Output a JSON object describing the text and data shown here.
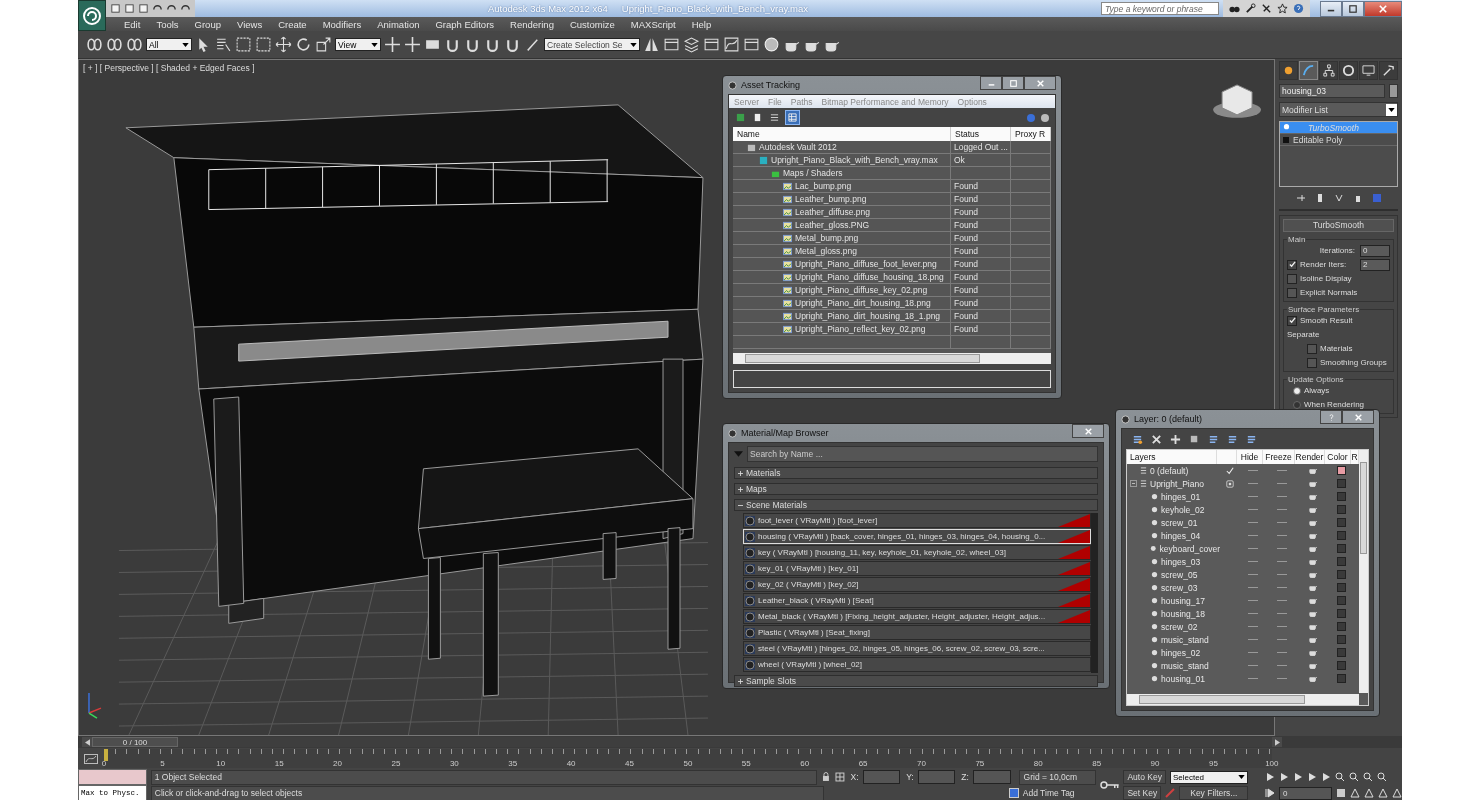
{
  "title_bar": {
    "app_title": "Autodesk 3ds Max  2012 x64",
    "file_name": "Upright_Piano_Black_with_Bench_vray.max",
    "search": {
      "placeholder": "Type a keyword or phrase"
    }
  },
  "menu": [
    "Edit",
    "Tools",
    "Group",
    "Views",
    "Create",
    "Modifiers",
    "Animation",
    "Graph Editors",
    "Rendering",
    "Customize",
    "MAXScript",
    "Help"
  ],
  "toolbar": {
    "selection_filter": "All",
    "reference_coord": "View",
    "selection_set": "Create Selection Se"
  },
  "viewport": {
    "label": "[ + ] [ Perspective ] [ Shaded + Edged Faces ]"
  },
  "asset_tracking": {
    "title": "Asset Tracking",
    "menu": [
      "Server",
      "File",
      "Paths",
      "Bitmap Performance and Memory",
      "Options"
    ],
    "tools": [
      {
        "kind": "refresh",
        "selected": false
      },
      {
        "kind": "page",
        "selected": false
      },
      {
        "kind": "list",
        "selected": false
      },
      {
        "kind": "table",
        "selected": true
      }
    ],
    "columns": [
      "Name",
      "Status",
      "Proxy R"
    ],
    "tree": [
      {
        "name": "Autodesk Vault 2012",
        "status": "Logged Out ...",
        "kind": "vault",
        "children": [
          {
            "name": "Upright_Piano_Black_with_Bench_vray.max",
            "status": "Ok",
            "kind": "scene",
            "children": [
              {
                "name": "Maps / Shaders",
                "kind": "folder",
                "children": [
                  {
                    "name": "Lac_bump.png",
                    "status": "Found",
                    "kind": "image"
                  },
                  {
                    "name": "Leather_bump.png",
                    "status": "Found",
                    "kind": "image"
                  },
                  {
                    "name": "Leather_diffuse.png",
                    "status": "Found",
                    "kind": "image"
                  },
                  {
                    "name": "Leather_gloss.PNG",
                    "status": "Found",
                    "kind": "image"
                  },
                  {
                    "name": "Metal_bump.png",
                    "status": "Found",
                    "kind": "image"
                  },
                  {
                    "name": "Metal_gloss.png",
                    "status": "Found",
                    "kind": "image"
                  },
                  {
                    "name": "Upright_Piano_diffuse_foot_lever.png",
                    "status": "Found",
                    "kind": "image"
                  },
                  {
                    "name": "Upright_Piano_diffuse_housing_18.png",
                    "status": "Found",
                    "kind": "image"
                  },
                  {
                    "name": "Upright_Piano_diffuse_key_02.png",
                    "status": "Found",
                    "kind": "image"
                  },
                  {
                    "name": "Upright_Piano_dirt_housing_18.png",
                    "status": "Found",
                    "kind": "image"
                  },
                  {
                    "name": "Upright_Piano_dirt_housing_18_1.png",
                    "status": "Found",
                    "kind": "image"
                  },
                  {
                    "name": "Upright_Piano_reflect_key_02.png",
                    "status": "Found",
                    "kind": "image"
                  }
                ]
              }
            ]
          }
        ]
      }
    ]
  },
  "material_browser": {
    "title": "Material/Map Browser",
    "search": {
      "placeholder": "Search by Name ..."
    },
    "groups": [
      {
        "label": "Materials",
        "expanded": false
      },
      {
        "label": "Maps",
        "expanded": false
      },
      {
        "label": "Scene Materials",
        "expanded": true,
        "items": [
          {
            "text": "foot_lever  ( VRayMtl ) [foot_lever]",
            "selected": false,
            "flagged": true
          },
          {
            "text": "housing  ( VRayMtl ) [back_cover, hinges_01, hinges_03, hinges_04, housing_0...",
            "selected": true,
            "flagged": true
          },
          {
            "text": "key  ( VRayMtl ) [housing_11, key, keyhole_01, keyhole_02, wheel_03]",
            "selected": false,
            "flagged": true
          },
          {
            "text": "key_01  ( VRayMtl ) [key_01]",
            "selected": false,
            "flagged": true
          },
          {
            "text": "key_02  ( VRayMtl ) [key_02]",
            "selected": false,
            "flagged": true
          },
          {
            "text": "Leather_black  ( VRayMtl ) [Seat]",
            "selected": false,
            "flagged": true
          },
          {
            "text": "Metal_black  ( VRayMtl ) [Fixing_height_adjuster, Height_adjuster, Height_adjus...",
            "selected": false,
            "flagged": true
          },
          {
            "text": "Plastic  ( VRayMtl ) [Seat_fixing]",
            "selected": false,
            "flagged": false
          },
          {
            "text": "steel  ( VRayMtl ) [hinges_02, hinges_05, hinges_06, screw_02, screw_03, scre...",
            "selected": false,
            "flagged": false
          },
          {
            "text": "wheel  ( VRayMtl ) [wheel_02]",
            "selected": false,
            "flagged": false
          }
        ]
      },
      {
        "label": "Sample Slots",
        "expanded": false
      }
    ]
  },
  "layer_manager": {
    "title": "Layer: 0 (default)",
    "columns": [
      "Layers",
      "Hide",
      "Freeze",
      "Render",
      "Color",
      "R"
    ],
    "layers": [
      {
        "name": "0 (default)",
        "current": true,
        "color": "#e89ca4"
      },
      {
        "name": "Upright_Piano",
        "current": false,
        "expanded": true,
        "color": "#3a3a3a",
        "children": [
          {
            "name": "hinges_01"
          },
          {
            "name": "keyhole_02"
          },
          {
            "name": "screw_01"
          },
          {
            "name": "hinges_04"
          },
          {
            "name": "keyboard_cover"
          },
          {
            "name": "hinges_03"
          },
          {
            "name": "screw_05"
          },
          {
            "name": "screw_03"
          },
          {
            "name": "housing_17"
          },
          {
            "name": "housing_18"
          },
          {
            "name": "screw_02"
          },
          {
            "name": "music_stand"
          },
          {
            "name": "hinges_02"
          },
          {
            "name": "music_stand"
          },
          {
            "name": "housing_01"
          }
        ]
      }
    ]
  },
  "command_panel": {
    "tabs": [
      {
        "kind": "create",
        "selected": false
      },
      {
        "kind": "modify",
        "selected": true
      },
      {
        "kind": "hierarchy",
        "selected": false
      },
      {
        "kind": "motion",
        "selected": false
      },
      {
        "kind": "display",
        "selected": false
      },
      {
        "kind": "utilities",
        "selected": false
      }
    ],
    "object_name": "housing_03",
    "modifier_list": "Modifier List",
    "stack": [
      {
        "label": "TurboSmooth",
        "kind": "modifier",
        "selected": true
      },
      {
        "label": "Editable Poly",
        "kind": "base",
        "selected": false
      }
    ],
    "rollout": {
      "title": "TurboSmooth",
      "sections": [
        {
          "label": "Main",
          "controls": [
            {
              "kind": "spinner",
              "label": "Iterations:",
              "value": "0"
            },
            {
              "kind": "check_spinner",
              "label": "Render Iters:",
              "value": "2",
              "checked": true
            },
            {
              "kind": "checkbox",
              "label": "Isoline Display",
              "checked": false
            },
            {
              "kind": "checkbox",
              "label": "Explicit Normals",
              "checked": false
            }
          ]
        },
        {
          "label": "Surface Parameters",
          "controls": [
            {
              "kind": "checkbox",
              "label": "Smooth Result",
              "checked": true
            },
            {
              "kind": "text",
              "label": "Separate"
            },
            {
              "kind": "sub_checkbox",
              "label": "Materials",
              "checked": false
            },
            {
              "kind": "sub_checkbox",
              "label": "Smoothing Groups",
              "checked": false
            }
          ]
        },
        {
          "label": "Update Options",
          "controls": [
            {
              "kind": "radio",
              "label": "Always",
              "selected": true
            },
            {
              "kind": "radio",
              "label": "When Rendering",
              "selected": false
            }
          ]
        }
      ]
    }
  },
  "timeline": {
    "position": "0 / 100",
    "level": 0,
    "ticks": [
      "0",
      "5",
      "10",
      "15",
      "20",
      "25",
      "30",
      "35",
      "40",
      "45",
      "50",
      "55",
      "60",
      "65",
      "70",
      "75",
      "80",
      "85",
      "90",
      "95",
      "100"
    ]
  },
  "status_bar": {
    "listener": "Max to Physc.",
    "selection": "1 Object Selected",
    "prompt": "Click or click-and-drag to select objects",
    "coords": [
      "X:",
      "Y:",
      "Z:"
    ],
    "grid": "Grid = 10,0cm",
    "add_time_tag": "Add Time Tag",
    "auto_key": "Auto Key",
    "key_mode": "Selected",
    "set_key": "Set Key",
    "key_filters": "Key Filters...",
    "frame": "0"
  }
}
